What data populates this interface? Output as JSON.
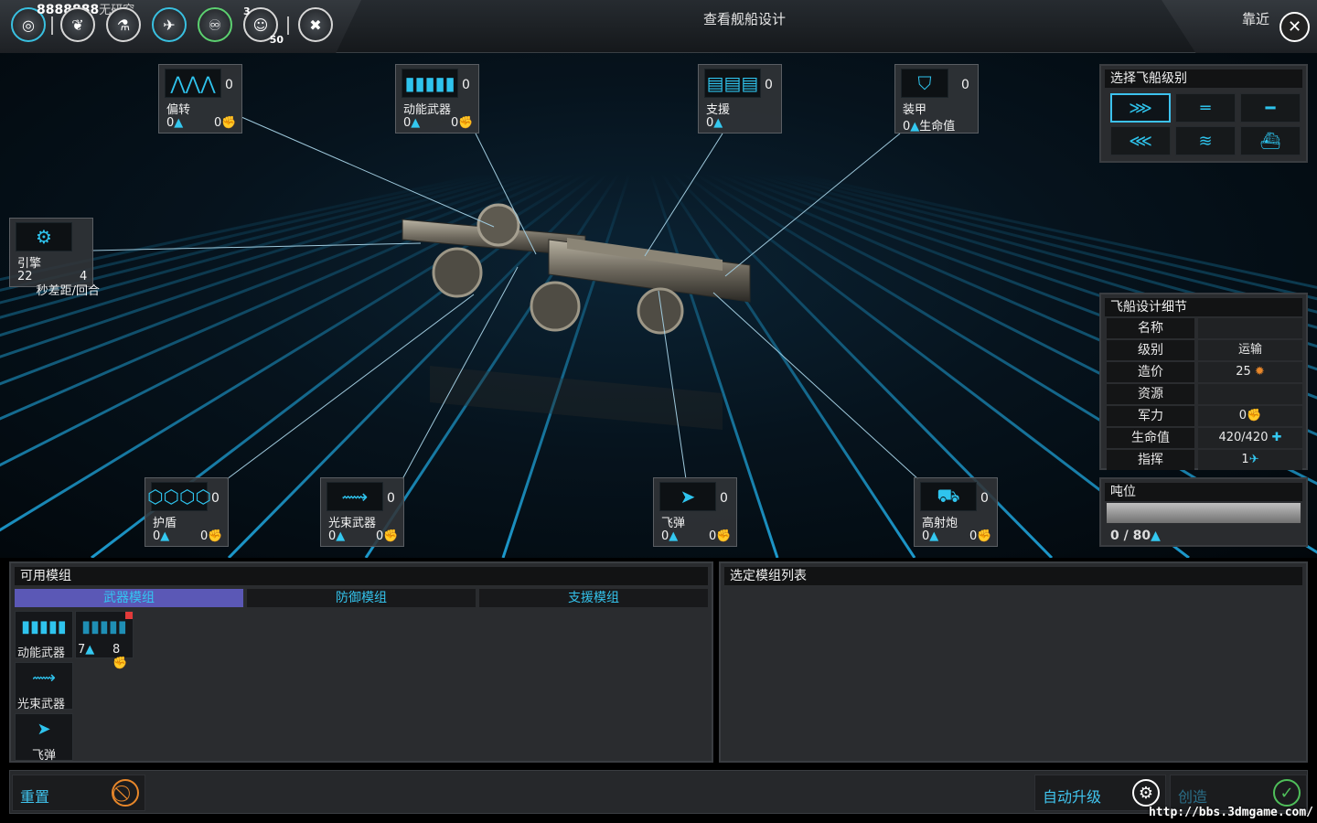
{
  "header": {
    "resource": "8888888",
    "research": "无研究",
    "title": "查看舰船设计",
    "zoom": "靠近",
    "close_glyph": "✕",
    "pop_badge_top": "3",
    "pop_badge_bottom": "50"
  },
  "slots": {
    "deflect": {
      "name": "偏转",
      "count": "0",
      "v1": "0",
      "v2": "0"
    },
    "kinetic": {
      "name": "动能武器",
      "count": "0",
      "v1": "0",
      "v2": "0"
    },
    "support": {
      "name": "支援",
      "count": "0",
      "v1": "0"
    },
    "armor": {
      "name": "装甲",
      "count": "0",
      "v1": "0",
      "v1_unit": "生命值"
    },
    "engine": {
      "name": "引擎",
      "v1": "22",
      "v2": "4",
      "unit": "秒差距/回合"
    },
    "shield": {
      "name": "护盾",
      "count": "0",
      "v1": "0",
      "v2": "0"
    },
    "beam": {
      "name": "光束武器",
      "count": "0",
      "v1": "0",
      "v2": "0"
    },
    "missile": {
      "name": "飞弹",
      "count": "0",
      "v1": "0",
      "v2": "0"
    },
    "flak": {
      "name": "高射炮",
      "count": "0",
      "v1": "0",
      "v2": "0"
    }
  },
  "ship_class_panel": {
    "title": "选择飞船级别"
  },
  "details_panel": {
    "title": "飞船设计细节",
    "rows": [
      {
        "label": "名称",
        "value": ""
      },
      {
        "label": "级别",
        "value": "运输"
      },
      {
        "label": "造价",
        "value": "25"
      },
      {
        "label": "资源",
        "value": ""
      },
      {
        "label": "军力",
        "value": "0"
      },
      {
        "label": "生命值",
        "value": "420/420"
      },
      {
        "label": "指挥",
        "value": "1"
      }
    ]
  },
  "tonnage_panel": {
    "title": "吨位",
    "value": "0 / 80",
    "fill_fraction": 0.0
  },
  "modules_panel": {
    "title": "可用模组",
    "tabs": [
      "武器模组",
      "防御模组",
      "支援模组"
    ],
    "active_tab": 0,
    "items": [
      {
        "name": "动能武器"
      },
      {
        "name": "",
        "v1": "7",
        "v2": "8"
      },
      {
        "name": "光束武器"
      },
      {
        "name": "飞弹"
      }
    ]
  },
  "selected_panel": {
    "title": "选定模组列表"
  },
  "bottom": {
    "reset": "重置",
    "auto_upgrade": "自动升级",
    "create": "创造"
  },
  "watermark": "http://bbs.3dmgame.com/",
  "colors": {
    "accent": "#34c8f0",
    "tab_active": "#5b58b6",
    "reset_icon": "#e8872a",
    "create_icon": "#4fbf5a"
  }
}
